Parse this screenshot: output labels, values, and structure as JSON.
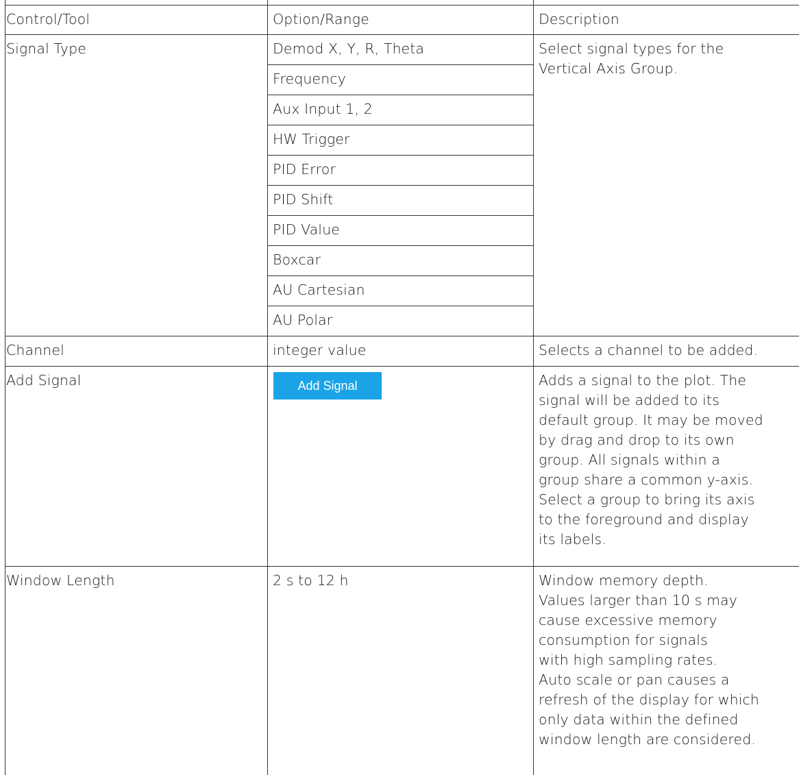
{
  "table": {
    "headers": {
      "col1": "Control/Tool",
      "col2": "Option/Range",
      "col3": "Description"
    },
    "signal_type": {
      "control": "Signal Type",
      "options": [
        "Demod X, Y, R, Theta",
        "Frequency",
        "Aux Input 1, 2",
        "HW Trigger",
        "PID Error",
        "PID Shift",
        "PID Value",
        "Boxcar",
        "AU Cartesian",
        "AU Polar"
      ],
      "description": [
        "Select signal types for the",
        "Vertical Axis Group."
      ]
    },
    "channel": {
      "control": "Channel",
      "option": "integer value",
      "description": "Selects a channel to be added."
    },
    "add_signal": {
      "control": "Add Signal",
      "button_label": "Add Signal",
      "button_color": "#1aa3e6",
      "description": [
        "Adds a signal to the plot. The",
        "signal will be added to its",
        "default group. It may be moved",
        "by drag and drop to its own",
        "group. All signals within a",
        "group share a common y-axis.",
        "Select a group to bring its axis",
        "to the foreground and display",
        "its labels."
      ]
    },
    "window_length": {
      "control": "Window Length",
      "option": "2 s to 12 h",
      "description": [
        "Window memory depth.",
        "Values larger than 10 s may",
        "cause excessive memory",
        "consumption for signals",
        "with high sampling rates.",
        "Auto scale or pan causes a",
        "refresh of the display for which",
        "only data within the defined",
        "window length are considered."
      ]
    }
  }
}
